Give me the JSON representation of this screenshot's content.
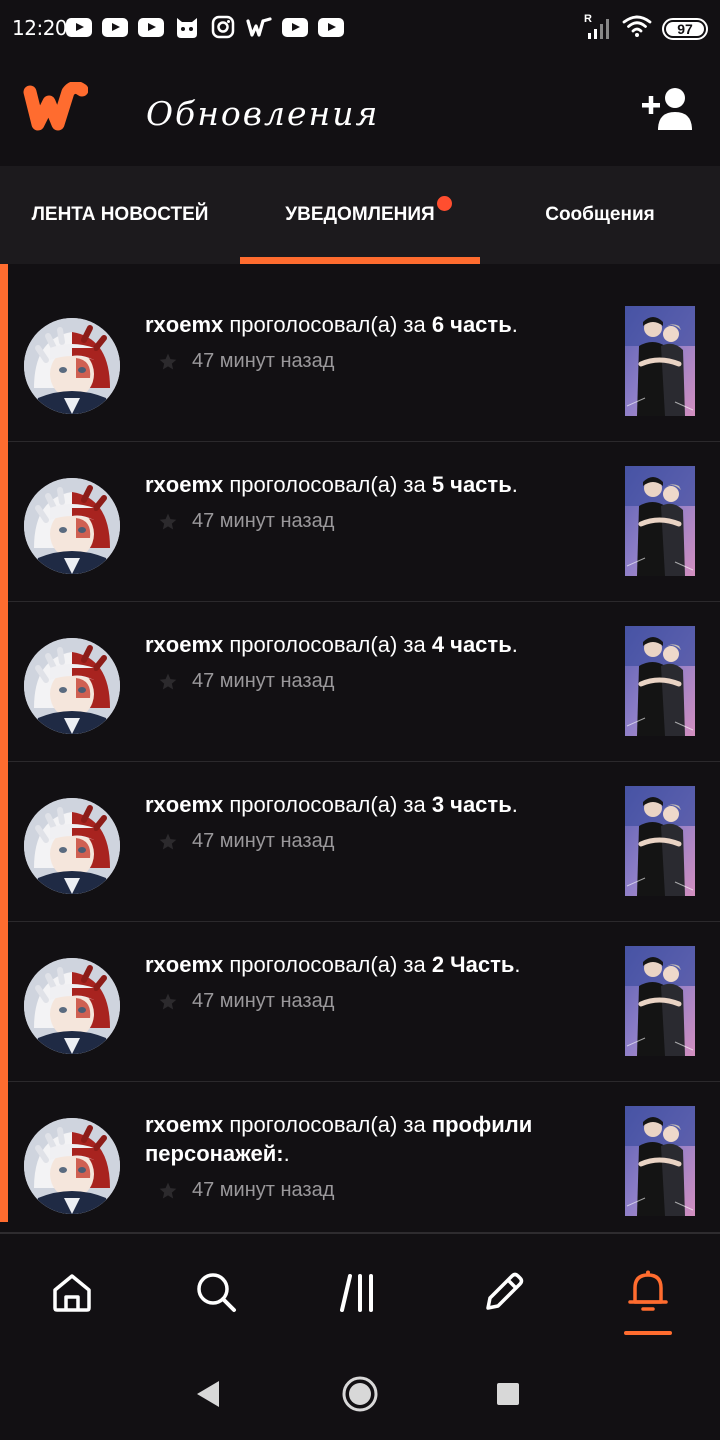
{
  "status_bar": {
    "time": "12:20",
    "battery": "97",
    "signal_label": "R"
  },
  "header": {
    "title": "Обновления"
  },
  "tabs": [
    {
      "label": "ЛЕНТА НОВОСТЕЙ",
      "active": false
    },
    {
      "label": "УВЕДОМЛЕНИЯ",
      "active": true,
      "has_dot": true
    },
    {
      "label": "Сообщения",
      "active": false
    }
  ],
  "notifications": [
    {
      "user": "rxoemx",
      "action": " проголосовал(а) за ",
      "target": "6 часть",
      "suffix": ".",
      "time": "47 минут назад"
    },
    {
      "user": "rxoemx",
      "action": " проголосовал(а) за ",
      "target": "5 часть",
      "suffix": ".",
      "time": "47 минут назад"
    },
    {
      "user": "rxoemx",
      "action": " проголосовал(а) за ",
      "target": "4 часть",
      "suffix": ".",
      "time": "47 минут назад"
    },
    {
      "user": "rxoemx",
      "action": " проголосовал(а) за ",
      "target": "3 часть",
      "suffix": ".",
      "time": "47 минут назад"
    },
    {
      "user": "rxoemx",
      "action": " проголосовал(а) за ",
      "target": "2 Часть",
      "suffix": ".",
      "time": "47 минут назад"
    },
    {
      "user": "rxoemx",
      "action": " проголосовал(а) за ",
      "target": "профили персонажей:",
      "suffix": ".",
      "time": "47 минут назад"
    }
  ],
  "bottom_nav": [
    {
      "icon": "home-icon",
      "active": false
    },
    {
      "icon": "search-icon",
      "active": false
    },
    {
      "icon": "library-icon",
      "active": false
    },
    {
      "icon": "pencil-icon",
      "active": false
    },
    {
      "icon": "bell-icon",
      "active": true
    }
  ],
  "colors": {
    "accent": "#ff6c2f",
    "background": "#121013",
    "tab_bar": "#1c1a1d",
    "muted_text": "#9a989b",
    "badge_dot": "#ff4e2f"
  }
}
